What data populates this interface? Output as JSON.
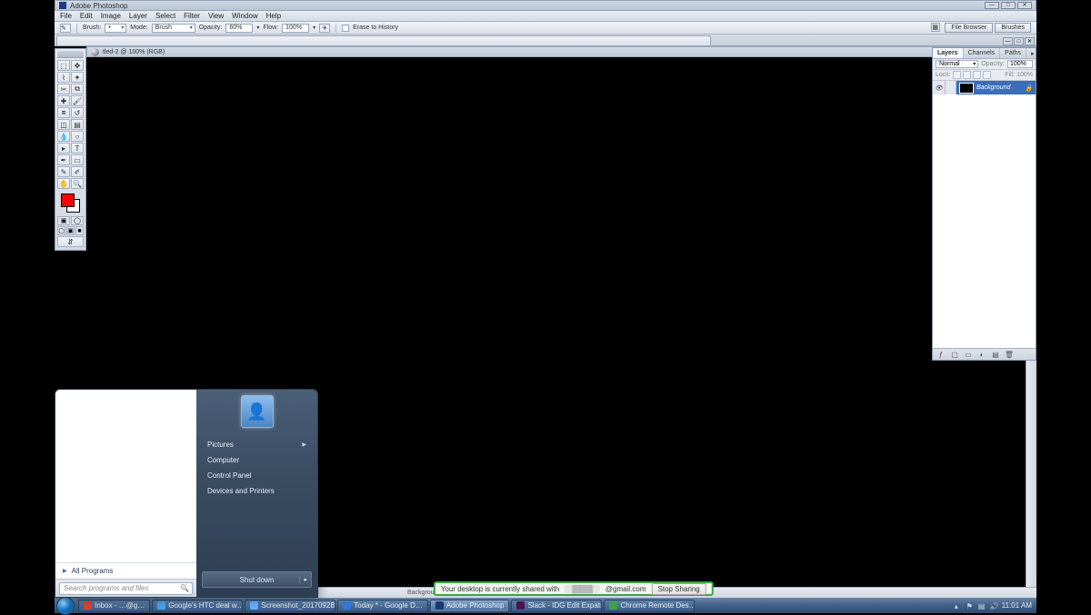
{
  "photoshop": {
    "title": "Adobe Photoshop",
    "menus": [
      "File",
      "Edit",
      "Image",
      "Layer",
      "Select",
      "Filter",
      "View",
      "Window",
      "Help"
    ],
    "options": {
      "brush_label": "Brush:",
      "mode_label": "Mode:",
      "mode_value": "Brush",
      "opacity_label": "Opacity:",
      "opacity_value": "60%",
      "flow_label": "Flow:",
      "flow_value": "100%",
      "erase_history": "Erase to History",
      "tabs": [
        "File Browser",
        "Brushes"
      ]
    },
    "document_title": "tled-2 @ 100% (RGB)",
    "status": "Background color. Use Shift, Alt, and Ctrl for additional options.",
    "tools": [
      [
        "marquee-tool",
        "move-tool"
      ],
      [
        "lasso-tool",
        "magic-wand-tool"
      ],
      [
        "crop-tool",
        "slice-tool"
      ],
      [
        "healing-brush-tool",
        "brush-tool"
      ],
      [
        "clone-stamp-tool",
        "history-brush-tool"
      ],
      [
        "eraser-tool",
        "gradient-tool"
      ],
      [
        "blur-tool",
        "dodge-tool"
      ],
      [
        "path-select-tool",
        "type-tool"
      ],
      [
        "pen-tool",
        "shape-tool"
      ],
      [
        "notes-tool",
        "eyedropper-tool"
      ],
      [
        "hand-tool",
        "zoom-tool"
      ]
    ],
    "swatch": {
      "fg": "#ff0000",
      "bg": "#ffffff"
    }
  },
  "layers_panel": {
    "tabs": [
      "Layers",
      "Channels",
      "Paths"
    ],
    "blend_mode": "Normal",
    "opacity_label": "Opacity:",
    "opacity": "100%",
    "lock_label": "Lock:",
    "fill_label": "Fill:",
    "fill": "100%",
    "layers": [
      {
        "name": "Background",
        "visible": true,
        "locked": true,
        "thumb": "#000000"
      }
    ]
  },
  "start_menu": {
    "items": [
      {
        "label": "Pictures",
        "submenu": true
      },
      {
        "label": "Computer",
        "submenu": false
      },
      {
        "label": "Control Panel",
        "submenu": false
      },
      {
        "label": "Devices and Printers",
        "submenu": false
      }
    ],
    "all_programs": "All Programs",
    "search_placeholder": "Search programs and files",
    "shutdown": "Shut down"
  },
  "share_toast": {
    "prefix": "Your desktop is currently shared with",
    "email_suffix": "@gmail.com",
    "stop": "Stop Sharing"
  },
  "taskbar": {
    "items": [
      {
        "label": "Inbox - …@g…",
        "color": "#d94434"
      },
      {
        "label": "Google's HTC deal w…",
        "color": "#45a3ee"
      },
      {
        "label": "Screenshot_2017092B…",
        "color": "#64b2ff"
      },
      {
        "label": "Today * - Google D…",
        "color": "#3278d6"
      },
      {
        "label": "Adobe Photoshop",
        "color": "#1b3870",
        "active": true
      },
      {
        "label": "Slack - IDG Edit Expats",
        "color": "#4a154b"
      },
      {
        "label": "Chrome Remote Des…",
        "color": "#3fa14d"
      }
    ],
    "clock": "11:01 AM"
  }
}
